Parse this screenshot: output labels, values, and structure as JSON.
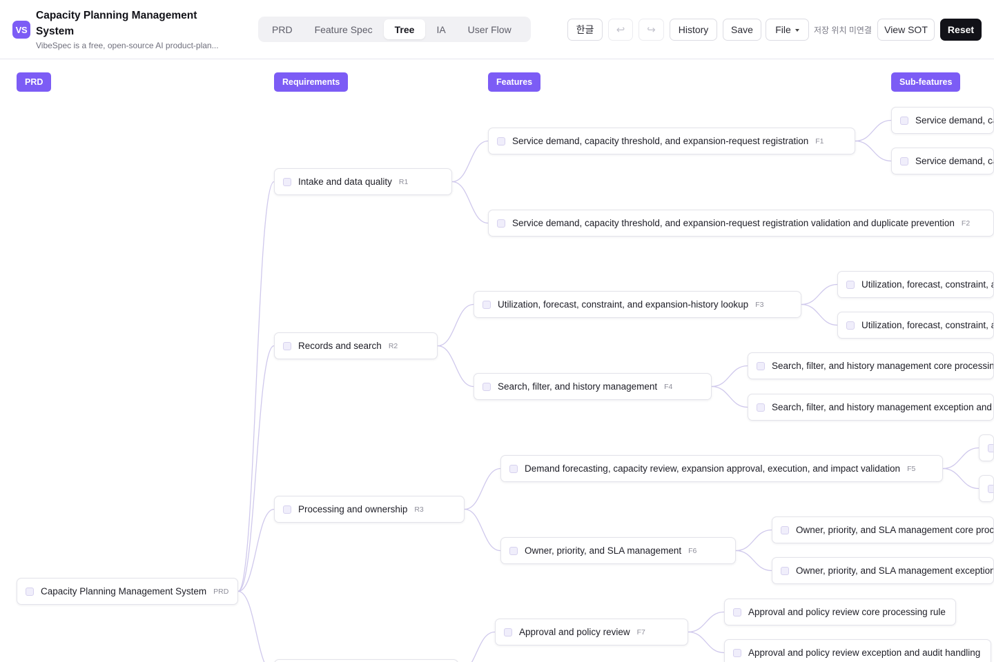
{
  "header": {
    "logo_text": "VS",
    "title": "Capacity Planning Management System",
    "subtitle": "VibeSpec is a free, open-source AI product-plan...",
    "tabs": [
      {
        "label": "PRD",
        "active": false
      },
      {
        "label": "Feature Spec",
        "active": false
      },
      {
        "label": "Tree",
        "active": true
      },
      {
        "label": "IA",
        "active": false
      },
      {
        "label": "User Flow",
        "active": false
      }
    ],
    "toolbar": {
      "language_label": "한글",
      "undo_icon": "↩",
      "redo_icon": "↪",
      "history_label": "History",
      "save_label": "Save",
      "file_label": "File",
      "save_status": "저장 위치 미연결",
      "view_sot_label": "View SOT",
      "reset_label": "Reset"
    }
  },
  "tree": {
    "columns": [
      {
        "label": "PRD"
      },
      {
        "label": "Requirements"
      },
      {
        "label": "Features"
      },
      {
        "label": "Sub-features"
      }
    ],
    "root": {
      "label": "Capacity Planning Management System",
      "code": "PRD"
    },
    "requirements": [
      {
        "label": "Intake and data quality",
        "code": "R1"
      },
      {
        "label": "Records and search",
        "code": "R2"
      },
      {
        "label": "Processing and ownership",
        "code": "R3"
      },
      {
        "label": "",
        "code": ""
      }
    ],
    "features": [
      {
        "label": "Service demand, capacity threshold, and expansion-request registration",
        "code": "F1"
      },
      {
        "label": "Service demand, capacity threshold, and expansion-request registration validation and duplicate prevention",
        "code": "F2"
      },
      {
        "label": "Utilization, forecast, constraint, and expansion-history lookup",
        "code": "F3"
      },
      {
        "label": "Search, filter, and history management",
        "code": "F4"
      },
      {
        "label": "Demand forecasting, capacity review, expansion approval, execution, and impact validation",
        "code": "F5"
      },
      {
        "label": "Owner, priority, and SLA management",
        "code": "F6"
      },
      {
        "label": "Approval and policy review",
        "code": "F7"
      }
    ],
    "subfeatures": [
      {
        "label": "Service demand, capacity threshold, and expansion-request registration core processing rule",
        "code": ""
      },
      {
        "label": "Service demand, capacity threshold, and expansion-request registration exception and audit handling",
        "code": ""
      },
      {
        "label": "Utilization, forecast, constraint, and expansion-history lookup core processing rule",
        "code": ""
      },
      {
        "label": "Utilization, forecast, constraint, and expansion-history lookup exception and audit handling",
        "code": ""
      },
      {
        "label": "Search, filter, and history management core processing rule",
        "code": ""
      },
      {
        "label": "Search, filter, and history management exception and audit handling",
        "code": ""
      },
      {
        "label": "",
        "code": ""
      },
      {
        "label": "",
        "code": ""
      },
      {
        "label": "Owner, priority, and SLA management core processing rule",
        "code": ""
      },
      {
        "label": "Owner, priority, and SLA management exception and audit handling",
        "code": ""
      },
      {
        "label": "Approval and policy review core processing rule",
        "code": ""
      },
      {
        "label": "Approval and policy review exception and audit handling",
        "code": ""
      }
    ]
  },
  "colors": {
    "accent": "#7c5cf5",
    "edge": "#cfc8ec",
    "dark_button": "#121218"
  }
}
